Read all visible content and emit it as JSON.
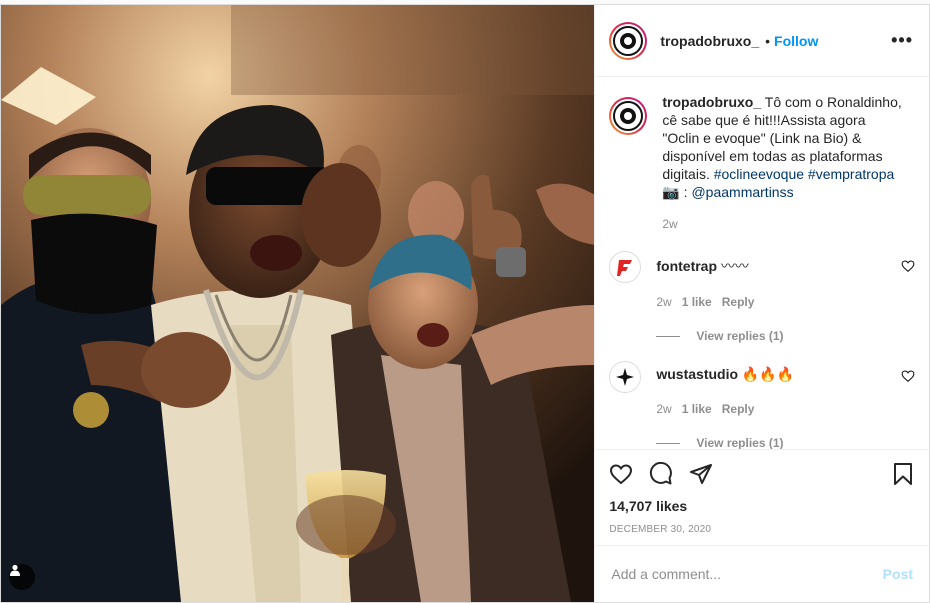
{
  "post": {
    "username": "tropadobruxo_",
    "follow_label": "Follow",
    "separator": "•",
    "more_label": "•••"
  },
  "caption": {
    "username": "tropadobruxo_",
    "text_1": "Tô com o Ronaldinho, cê sabe que é hit!!!Assista agora \"Oclin e evoque\" (Link na Bio) & disponível em todas as plataformas digitais. ",
    "hashtag_1": "#oclineevoque",
    "hashtag_2": "#vempratropa",
    "text_2": "📷 : ",
    "mention": "@paammartinss",
    "age": "2w"
  },
  "comments": [
    {
      "username": "fontetrap",
      "text": "〰〰",
      "age": "2w",
      "likes": "1 like",
      "reply_label": "Reply",
      "view_replies": "View replies (1)"
    },
    {
      "username": "wustastudio",
      "text": "🔥🔥🔥",
      "age": "2w",
      "likes": "1 like",
      "reply_label": "Reply",
      "view_replies": "View replies (1)"
    }
  ],
  "stats": {
    "likes": "14,707 likes",
    "date": "DECEMBER 30, 2020"
  },
  "add_comment": {
    "placeholder": "Add a comment...",
    "post_label": "Post"
  },
  "icons": {
    "like": "heart-icon",
    "comment": "comment-icon",
    "share": "paper-plane-icon",
    "save": "bookmark-icon",
    "user_tag": "user-icon"
  },
  "colors": {
    "accent": "#0095f6",
    "post_disabled": "#b2dffc",
    "link": "#00376b",
    "muted": "#8e8e8e"
  }
}
